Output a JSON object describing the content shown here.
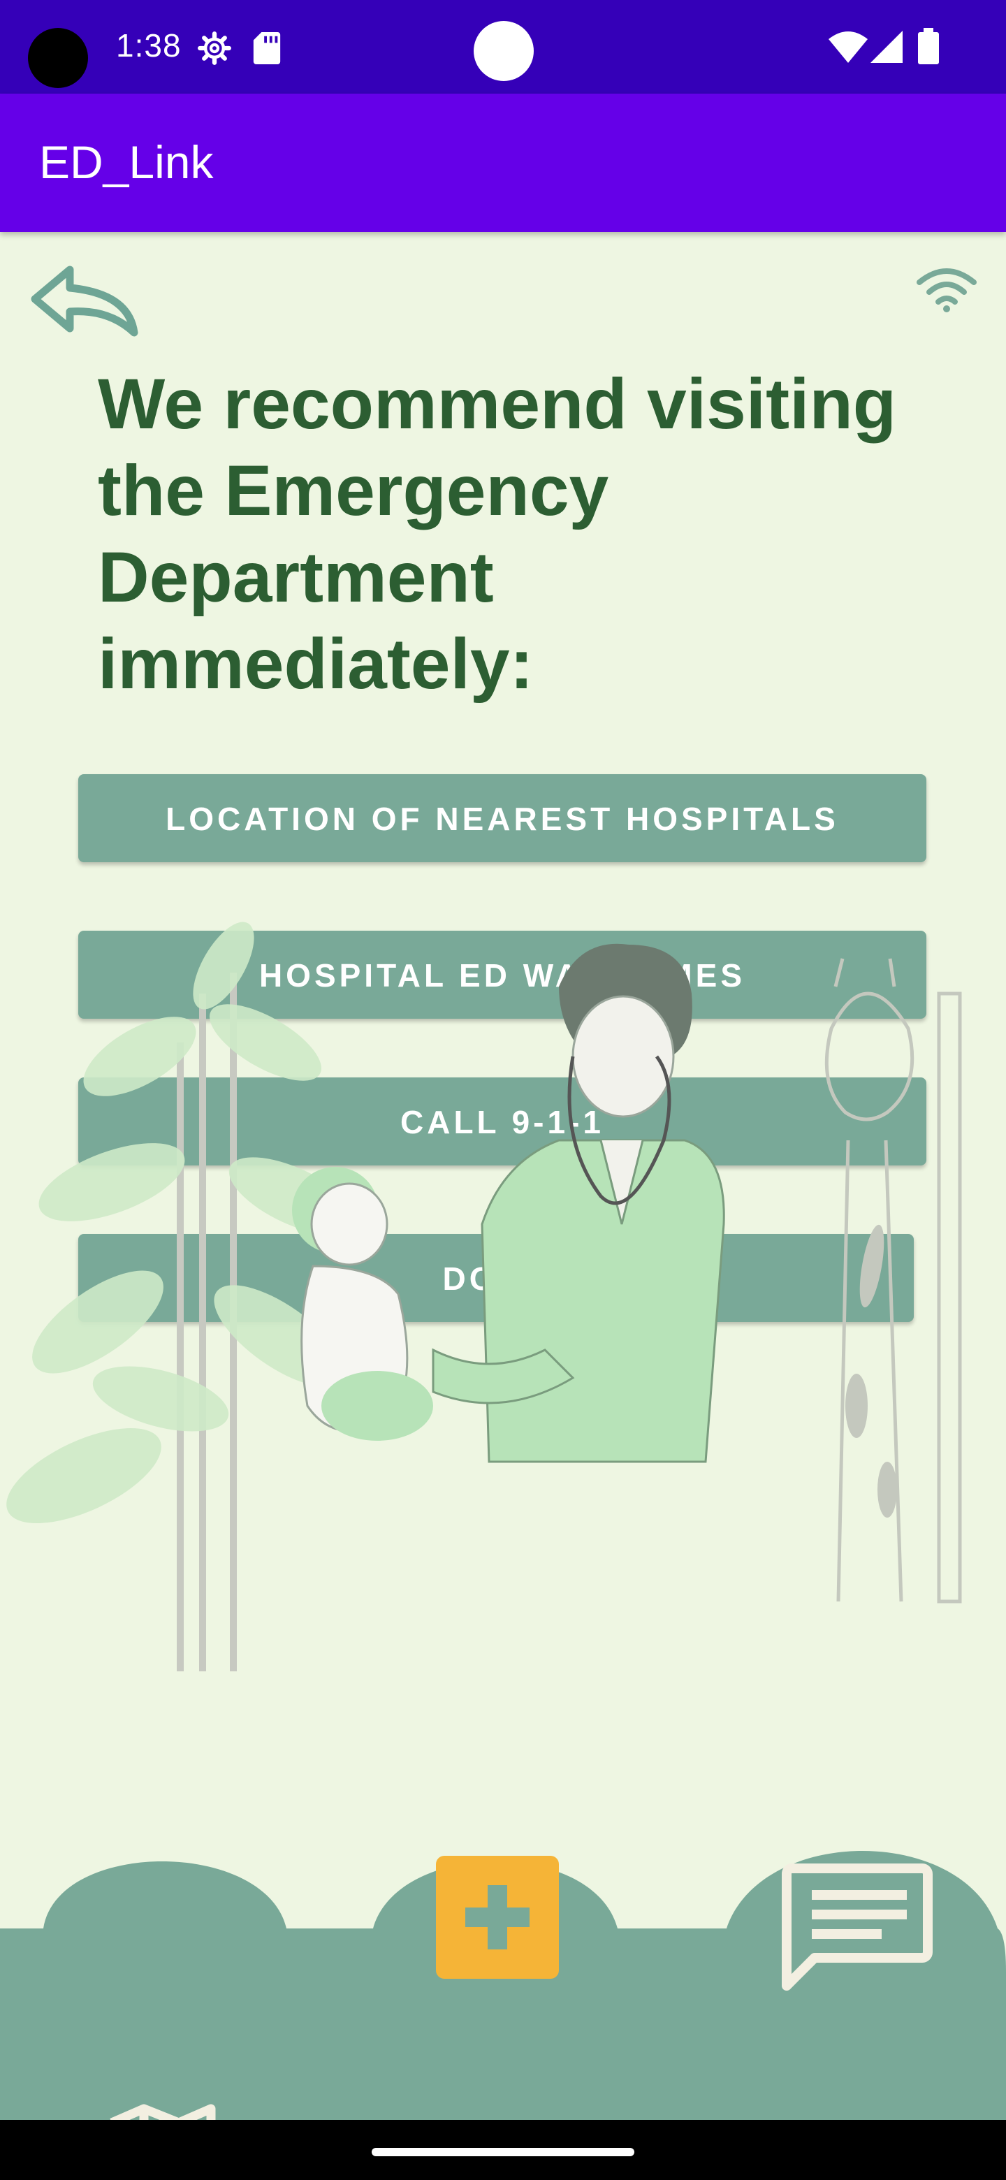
{
  "status_bar": {
    "time": "1:38"
  },
  "app_bar": {
    "title": "ED_Link"
  },
  "main": {
    "headline": "We recommend visiting the Emergency Department immediately:",
    "buttons": {
      "hospitals": "LOCATION OF NEAREST HOSPITALS",
      "wait_times": "HOSPITAL ED WAIT TIMES",
      "call": "CALL 9-1-1",
      "done": "DONE"
    }
  },
  "colors": {
    "status_bar": "#3500b8",
    "app_bar": "#6500e8",
    "background": "#eef6e2",
    "heading": "#2c5e32",
    "button": "#79a998",
    "nav": "#79a998",
    "accent": "#f5b437"
  },
  "icons": [
    "settings-icon",
    "sd-card-icon",
    "wifi-icon",
    "signal-icon",
    "battery-icon",
    "back-icon",
    "map-search-icon",
    "plus-icon",
    "chat-icon"
  ]
}
